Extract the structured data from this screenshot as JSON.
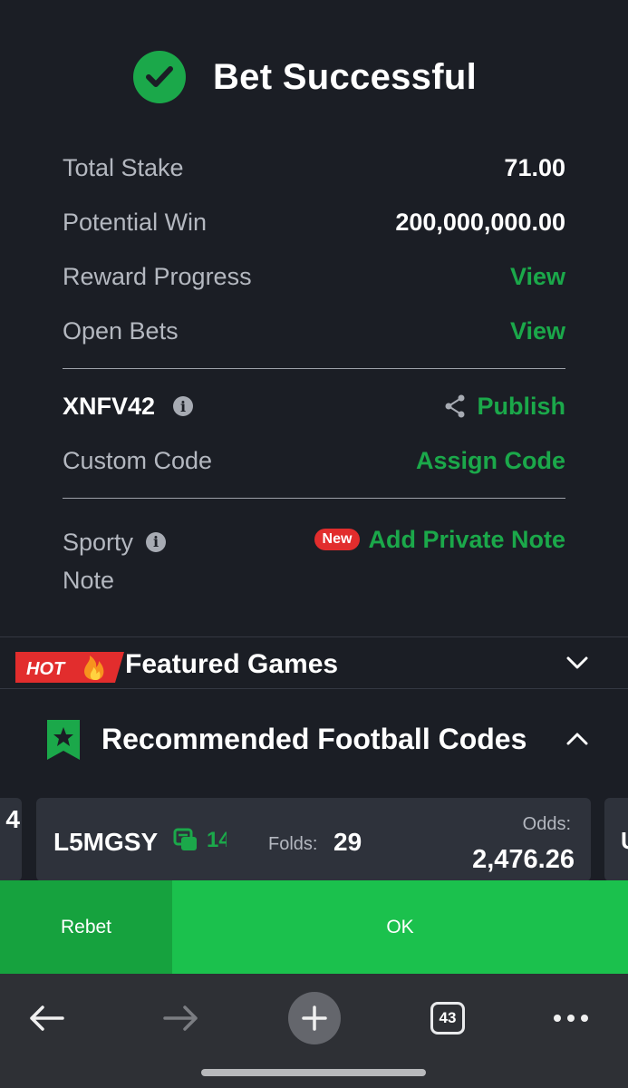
{
  "header": {
    "title": "Bet Successful",
    "icon": "check-circle-icon"
  },
  "summary": {
    "total_stake_label": "Total Stake",
    "total_stake_value": "71.00",
    "potential_win_label": "Potential Win",
    "potential_win_value": "200,000,000.00",
    "reward_progress_label": "Reward Progress",
    "reward_progress_link": "View",
    "open_bets_label": "Open Bets",
    "open_bets_link": "View"
  },
  "booking": {
    "code": "XNFV42",
    "publish_label": "Publish",
    "custom_code_label": "Custom Code",
    "assign_code_label": "Assign Code"
  },
  "note": {
    "label_line1": "Sporty",
    "label_line2": "Note",
    "new_badge": "New",
    "add_note_label": "Add Private Note"
  },
  "featured": {
    "hot_badge": "HOT",
    "title": "Featured Games"
  },
  "recommended": {
    "title": "Recommended Football Codes",
    "prev_card_fragment": "4",
    "next_card_fragment": "U",
    "card": {
      "code": "L5MGSY",
      "ticket_count": "14",
      "folds_label": "Folds:",
      "folds_value": "29",
      "odds_label": "Odds:",
      "odds_value": "2,476.26"
    }
  },
  "actions": {
    "rebet_label": "Rebet",
    "ok_label": "OK"
  },
  "browser_nav": {
    "tab_count": "43"
  },
  "colors": {
    "accent_green": "#1ba84a",
    "ok_green": "#1bc14d",
    "rebet_green": "#16a23e",
    "background": "#1b1e25",
    "badge_red": "#e22d2d"
  }
}
